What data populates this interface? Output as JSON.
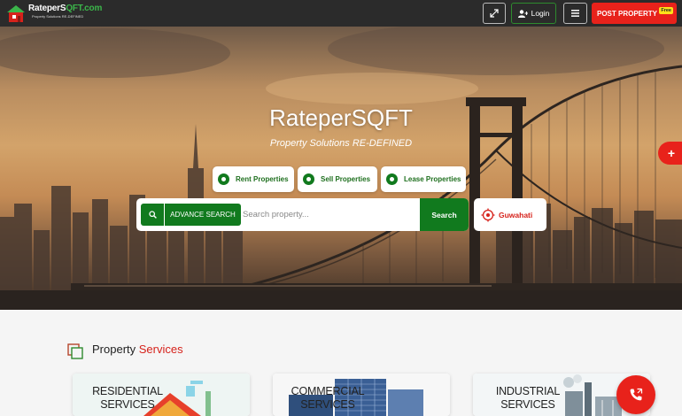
{
  "header": {
    "logo_main": "RateperS",
    "logo_accent": "QFT.com",
    "logo_tagline": "Property Solutions RE-DEFINED",
    "login_label": "Login",
    "post_property_label": "POST PROPERTY",
    "free_badge": "Free"
  },
  "hero": {
    "title": "RateperSQFT",
    "subtitle": "Property Solutions RE-DEFINED",
    "tabs": [
      {
        "label": "Rent Properties"
      },
      {
        "label": "Sell Properties"
      },
      {
        "label": "Lease Properties"
      }
    ],
    "advance_search_label": "ADVANCE SEARCH",
    "search_placeholder": "Search property...",
    "search_button_label": "Search",
    "location_label": "Guwahati"
  },
  "services": {
    "heading_prefix": "Property",
    "heading_accent": "Services",
    "cards": [
      {
        "line1": "RESIDENTIAL",
        "line2": "SERVICES"
      },
      {
        "line1": "COMMERCIAL",
        "line2": "SERVICES"
      },
      {
        "line1": "INDUSTRIAL",
        "line2": "SERVICES"
      }
    ]
  },
  "colors": {
    "brand_green": "#117a1e",
    "brand_red": "#e8221b",
    "header_bg": "#2b2b2b"
  },
  "icons": [
    "logo-house-icon",
    "expand-icon",
    "user-plus-icon",
    "hamburger-icon",
    "search-icon",
    "target-pin-icon",
    "plus-icon",
    "phone-call-icon",
    "stacked-squares-icon"
  ]
}
